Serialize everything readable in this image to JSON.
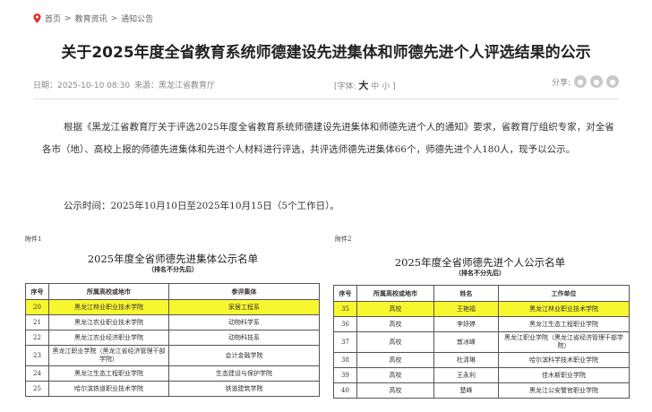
{
  "breadcrumb": {
    "icon": "location-pin-icon",
    "items": [
      "首页",
      "教育资讯",
      "通知公告"
    ],
    "separator": ">"
  },
  "article": {
    "title": "关于2025年度全省教育系统师德建设先进集体和师德先进个人评选结果的公示",
    "date": "日期：2025-10-10 08:30",
    "source": "来源：黑龙江省教育厅",
    "font_label": "[字体:",
    "font_large": "大",
    "font_medium": "中",
    "font_small": "小",
    "font_close": "]",
    "share_label": "分享:",
    "share_icons": [
      "wechat-icon",
      "weibo-icon",
      "qq-icon"
    ],
    "paragraph1": "根据《黑龙江省教育厅关于评选2025年度全省教育系统师德建设先进集体和师德先进个人的通知》要求，省教育厅组织专家，对全省各市（地）、高校上报的师德先进集体和先进个人材料进行评选，共评选师德先进集体66个，师德先进个人180人，现予以公示。",
    "paragraph2": "公示时间：2025年10月10日至2025年10月15日（5个工作日）。"
  },
  "table1": {
    "attachment": "附件1",
    "title": "2025年度全省师德先进集体公示名单",
    "subtitle": "（排名不分先后）",
    "headers": [
      "序号",
      "所属高校或地市",
      "参评集体"
    ],
    "rows": [
      {
        "no": "20",
        "unit": "黑龙江林业职业技术学院",
        "group": "家居工程系",
        "highlight": true
      },
      {
        "no": "21",
        "unit": "黑龙江农业职业技术学院",
        "group": "动物科学系",
        "highlight": false
      },
      {
        "no": "22",
        "unit": "黑龙江农业经济职业学院",
        "group": "动物科技系",
        "highlight": false
      },
      {
        "no": "23",
        "unit": "黑龙江职业学院（黑龙江省经济管理干部学院）",
        "group": "会计金融学院",
        "highlight": false,
        "tall": true
      },
      {
        "no": "24",
        "unit": "黑龙江生态工程职业学院",
        "group": "生态建设与保护学院",
        "highlight": false
      },
      {
        "no": "25",
        "unit": "哈尔滨铁道职业技术学院",
        "group": "铁道建筑学院",
        "highlight": false
      }
    ]
  },
  "table2": {
    "attachment": "附件2",
    "title": "2025年度全省师德先进个人公示名单",
    "subtitle": "（排名不分先后）",
    "headers": [
      "序号",
      "所属高校或地市",
      "姓名",
      "工作单位"
    ],
    "rows": [
      {
        "no": "35",
        "unit": "高校",
        "name": "王艳福",
        "work": "黑龙江林业职业技术学院",
        "highlight": true
      },
      {
        "no": "36",
        "unit": "高校",
        "name": "李妤婷",
        "work": "黑龙江生态工程职业学院",
        "highlight": false
      },
      {
        "no": "37",
        "unit": "高校",
        "name": "敦冰峰",
        "work": "黑龙江职业学院（黑龙江省经济管理干部学院）",
        "highlight": false,
        "tall": true
      },
      {
        "no": "38",
        "unit": "高校",
        "name": "杜清琳",
        "work": "哈尔滨科学技术职业学院",
        "highlight": false
      },
      {
        "no": "39",
        "unit": "高校",
        "name": "王永利",
        "work": "佳木斯职业学院",
        "highlight": false
      },
      {
        "no": "40",
        "unit": "高校",
        "name": "楚峰",
        "work": "黑龙江公安警官职业学院",
        "highlight": false
      }
    ]
  },
  "colors": {
    "highlight": "#f7f730",
    "pin": "#d9342b"
  }
}
